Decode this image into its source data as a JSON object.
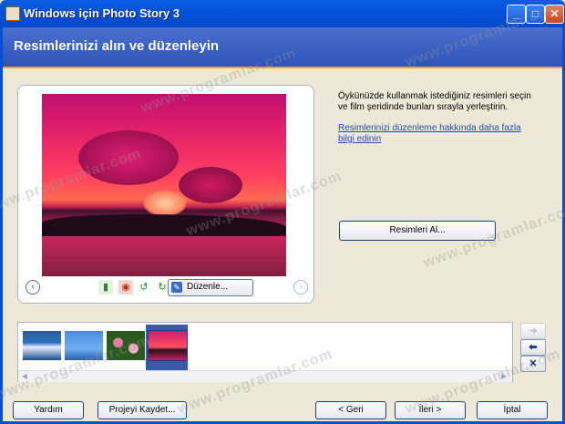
{
  "window": {
    "title": "Windows için Photo Story 3",
    "minimize": "_",
    "maximize": "□",
    "close": "✕"
  },
  "header": {
    "heading": "Resimlerinizi alın ve düzenleyin"
  },
  "preview": {
    "edit_label": "Düzenle..."
  },
  "instructions": {
    "text": "Öykünüzde kullanmak istediğiniz resimleri seçin ve film şeridinde bunları sırayla yerleştirin.",
    "help_link": "Resimlerinizi düzenleme hakkında daha fazla bilgi edinin",
    "get_pictures_label": "Resimleri Al..."
  },
  "filmstrip": {
    "thumbnails": [
      {
        "name": "ocean-wave"
      },
      {
        "name": "blue-sky"
      },
      {
        "name": "flowers"
      },
      {
        "name": "sunset",
        "selected": true
      }
    ]
  },
  "side_buttons": {
    "forward": "➜",
    "back": "⬅",
    "remove": "✕"
  },
  "footer": {
    "help_label": "Yardım",
    "save_project_label": "Projeyi Kaydet...",
    "back_label": "< Geri",
    "next_label": "İleri >",
    "cancel_label": "İptal"
  },
  "watermark": "www.programlar.com",
  "colors": {
    "title_bar": "#0451d8",
    "header": "#3a5fc4",
    "accent_line": "#f0a030",
    "link": "#2a4aa8"
  }
}
